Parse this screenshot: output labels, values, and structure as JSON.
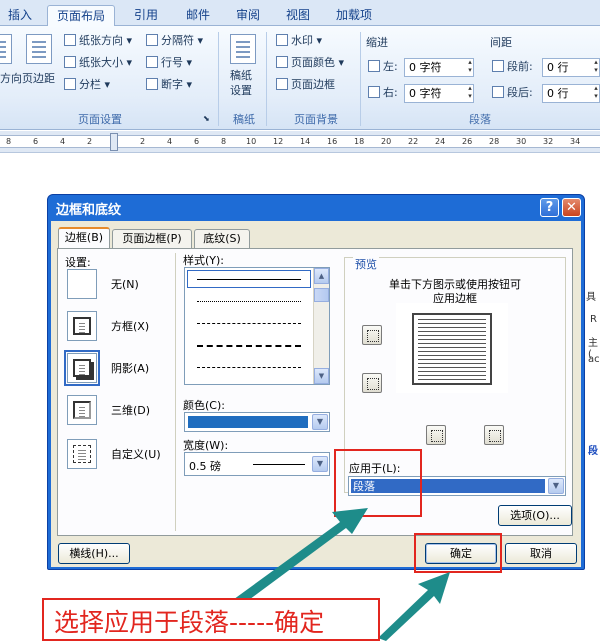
{
  "ribbon": {
    "tabs": [
      "插入",
      "页面布局",
      "引用",
      "邮件",
      "审阅",
      "视图",
      "加载项"
    ],
    "active_tab": "页面布局",
    "page_setup": {
      "left_cut": "方向",
      "margins": "页边距",
      "orientation": "纸张方向",
      "size": "纸张大小",
      "columns": "分栏",
      "breaks": "分隔符",
      "line_numbers": "行号",
      "hyphenation": "断字",
      "label": "页面设置"
    },
    "draft": {
      "button": "稿纸设置",
      "line1": "稿纸",
      "line2": "设置",
      "label": "稿纸"
    },
    "background": {
      "watermark": "水印",
      "page_color": "页面颜色",
      "page_borders": "页面边框",
      "label": "页面背景"
    },
    "indent": {
      "title": "缩进",
      "left_label": "左:",
      "left_value": "0 字符",
      "right_label": "右:",
      "right_value": "0 字符"
    },
    "spacing": {
      "title": "间距",
      "before_label": "段前:",
      "before_value": "0 行",
      "after_label": "段后:",
      "after_value": "0 行"
    },
    "paragraph_label": "段落"
  },
  "ruler": {
    "ticks": [
      "8",
      "6",
      "4",
      "2",
      "2",
      "4",
      "6",
      "8",
      "10",
      "12",
      "14",
      "16",
      "18",
      "20",
      "22",
      "24",
      "26",
      "28",
      "30",
      "32",
      "34"
    ]
  },
  "doc_fragments": [
    "具",
    "R",
    "主(",
    "ac",
    "段"
  ],
  "dialog": {
    "title": "边框和底纹",
    "help": "?",
    "close": "✕",
    "tabs": [
      "边框(B)",
      "页面边框(P)",
      "底纹(S)"
    ],
    "settings_title": "设置:",
    "settings": [
      "无(N)",
      "方框(X)",
      "阴影(A)",
      "三维(D)",
      "自定义(U)"
    ],
    "style_label": "样式(Y):",
    "color_label": "颜色(C):",
    "width_label": "宽度(W):",
    "width_value": "0.5 磅",
    "preview_title": "预览",
    "preview_hint_1": "单击下方图示或使用按钮可",
    "preview_hint_2": "应用边框",
    "apply_to_label": "应用于(L):",
    "apply_to_value": "段落",
    "options_button": "选项(O)...",
    "horizontal_line_button": "横线(H)...",
    "ok_button": "确定",
    "cancel_button": "取消"
  },
  "annotation": "选择应用于段落-----确定",
  "colors": {
    "annotation": "#e2261f",
    "arrow": "#1e8c8a",
    "dialog_title": "#1e6cd6",
    "selection": "#316ac5",
    "border_color": "#1f6dbf"
  }
}
